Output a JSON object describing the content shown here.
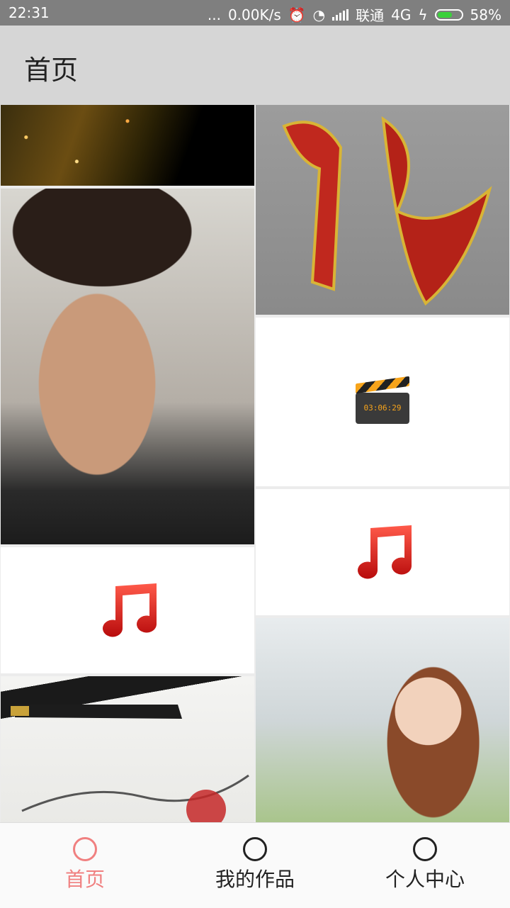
{
  "status_bar": {
    "time": "22:31",
    "dots": "...",
    "speed": "0.00K/s",
    "carrier": "联通",
    "network": "4G",
    "battery_percent": "58%",
    "battery_level": 0.58
  },
  "app_bar": {
    "title": "首页"
  },
  "grid": {
    "left": [
      {
        "kind": "image",
        "icon": "city-night-photo"
      },
      {
        "kind": "image",
        "icon": "man-portrait-photo"
      },
      {
        "kind": "audio",
        "icon": "music-note-icon"
      },
      {
        "kind": "image",
        "icon": "signature-photo"
      }
    ],
    "right": [
      {
        "kind": "image",
        "icon": "dragon-calligraphy-image"
      },
      {
        "kind": "video",
        "icon": "clapperboard-icon",
        "video_time": "03:06:29"
      },
      {
        "kind": "audio",
        "icon": "music-note-icon"
      },
      {
        "kind": "image",
        "icon": "woman-portrait-photo"
      }
    ]
  },
  "bottom_nav": {
    "items": [
      {
        "label": "首页",
        "active": true
      },
      {
        "label": "我的作品",
        "active": false
      },
      {
        "label": "个人中心",
        "active": false
      }
    ],
    "active_color": "#f08080"
  }
}
